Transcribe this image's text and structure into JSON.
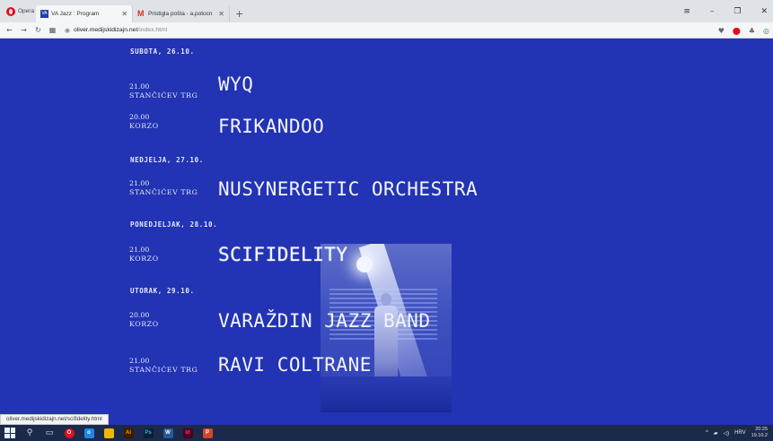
{
  "browser": {
    "opera_label": "Opera",
    "tabs": [
      {
        "title": "VA Jazz : Program",
        "favicon": "VA",
        "active": true
      },
      {
        "title": "Pristigla pošta - a.potocn",
        "favicon": "M",
        "active": false
      }
    ],
    "new_tab": "+",
    "url_host": "oliver.medijskidizajn.net",
    "url_path": "/index.html"
  },
  "program": {
    "days": [
      {
        "header": "SUBOTA, 26.10."
      },
      {
        "header": "NEDJELJA, 27.10."
      },
      {
        "header": "PONEDJELJAK, 28.10."
      },
      {
        "header": "UTORAK, 29.10."
      }
    ],
    "events": [
      {
        "time": "21.00",
        "venue": "STANČIĆEV TRG",
        "performer": "WYQ"
      },
      {
        "time": "20.00",
        "venue": "KORZO",
        "performer": "FRIKANDOO"
      },
      {
        "time": "21.00",
        "venue": "STANČIĆEV TRG",
        "performer": "NUSYNERGETIC ORCHESTRA"
      },
      {
        "time": "21.00",
        "venue": "KORZO",
        "performer": "SCIFIDELITY"
      },
      {
        "time": "20.00",
        "venue": "KORZO",
        "performer": "VARAŽDIN JAZZ BAND"
      },
      {
        "time": "21.00",
        "venue": "STANČIĆEV TRG",
        "performer": "RAVI COLTRANE"
      }
    ]
  },
  "status_bar": {
    "link": "oliver.medijskidizajn.net/scifidelity.html"
  },
  "taskbar": {
    "language": "HRV",
    "time": "20:25",
    "date": "19.10.2"
  }
}
